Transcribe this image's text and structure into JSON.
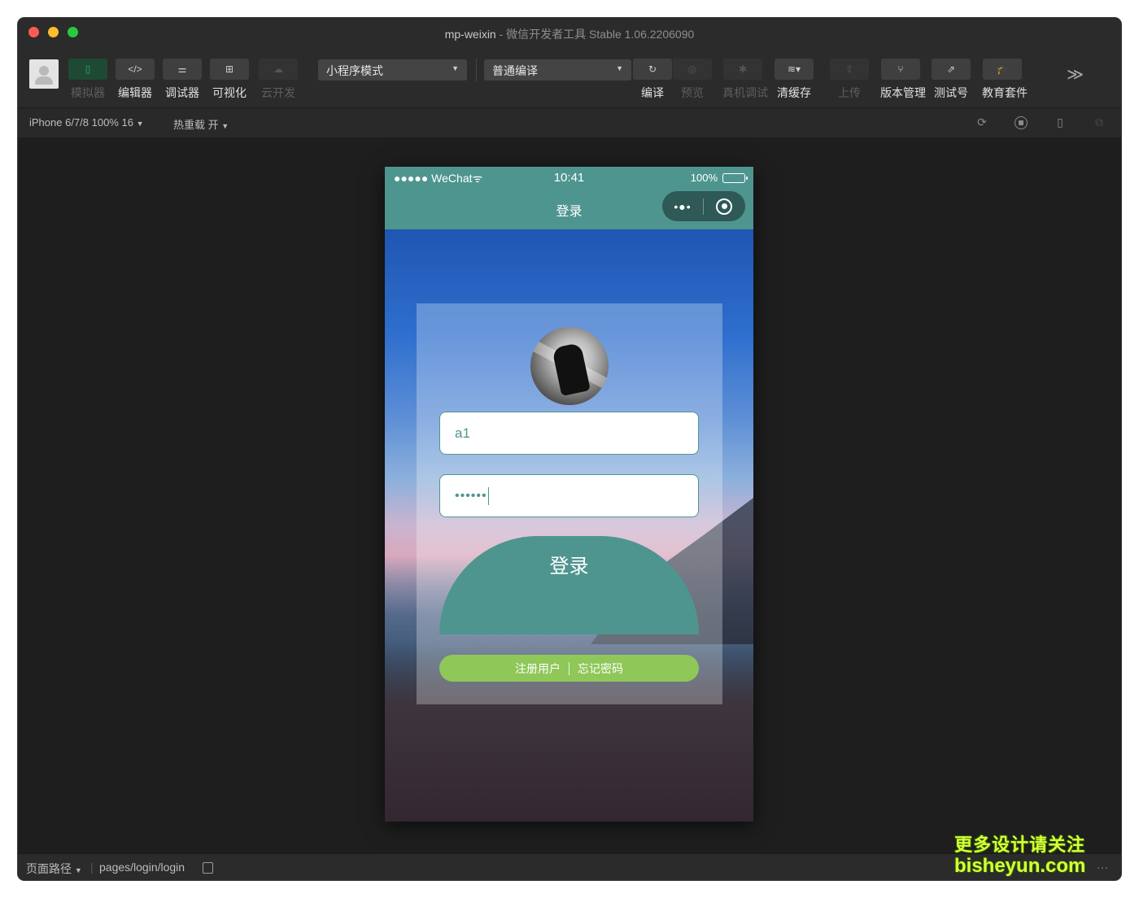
{
  "window": {
    "app_name": "mp-weixin",
    "title_rest": " - 微信开发者工具 Stable 1.06.2206090"
  },
  "toolbar": {
    "simulator": "模拟器",
    "editor": "编辑器",
    "debugger": "调试器",
    "visual": "可视化",
    "cloud": "云开发",
    "mode_select": "小程序模式",
    "compile_select": "普通编译",
    "compile": "编译",
    "preview": "预览",
    "remote_debug": "真机调试",
    "clear_cache": "清缓存",
    "upload": "上传",
    "version": "版本管理",
    "test_account": "测试号",
    "edu_kit": "教育套件",
    "editor_glyph": "</>",
    "more_glyph": "≫"
  },
  "subbar": {
    "device": "iPhone 6/7/8 100% 16",
    "hot_reload": "热重载 开"
  },
  "phone": {
    "carrier": "●●●●● WeChat",
    "wifi_glyph": "ᯤ",
    "time": "10:41",
    "battery": "100%",
    "nav_title": "登录",
    "capsule_dots": "•●•",
    "username_value": "a1",
    "password_value": "••••••",
    "login_button": "登录",
    "register_link": "注册用户",
    "forgot_link": "忘记密码"
  },
  "footer": {
    "page_path_label": "页面路径",
    "page_path": "pages/login/login",
    "more": "···"
  },
  "watermark": {
    "line1": "更多设计请关注",
    "line2": "bisheyun.com"
  },
  "colors": {
    "theme": "#4f958f",
    "link_bar": "#8fc759",
    "editor_bg": "#1f1f1f"
  }
}
